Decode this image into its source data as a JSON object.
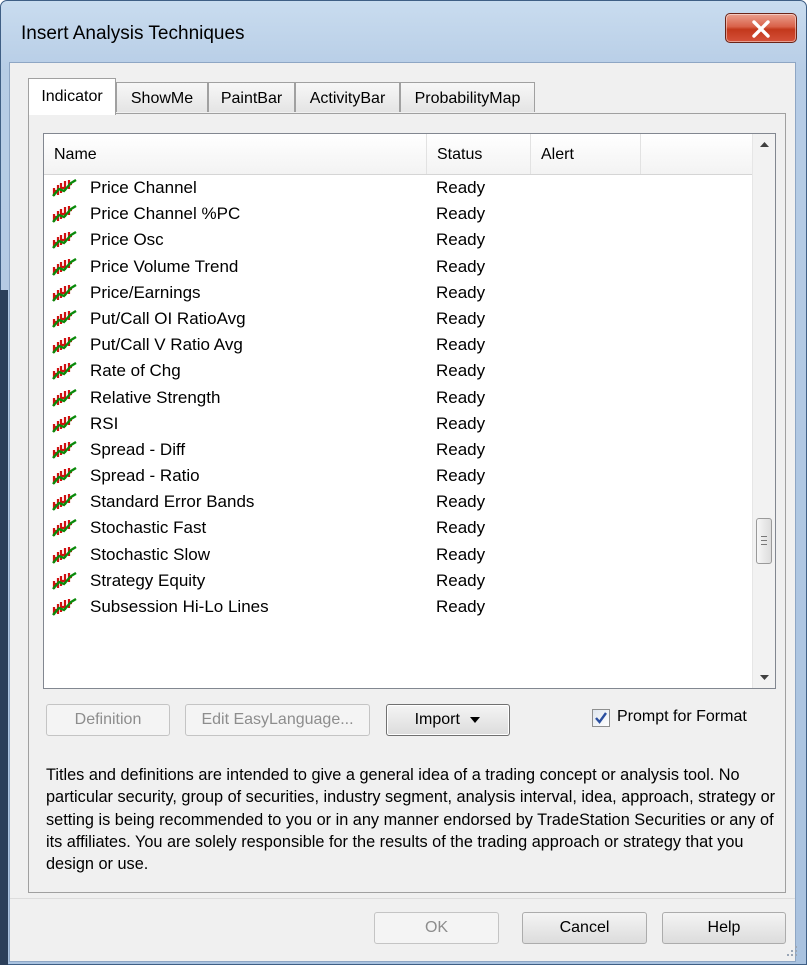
{
  "window": {
    "title": "Insert Analysis Techniques",
    "close_icon": "close-icon"
  },
  "tabs": [
    {
      "label": "Indicator",
      "active": true
    },
    {
      "label": "ShowMe",
      "active": false
    },
    {
      "label": "PaintBar",
      "active": false
    },
    {
      "label": "ActivityBar",
      "active": false
    },
    {
      "label": "ProbabilityMap",
      "active": false
    }
  ],
  "list": {
    "columns": [
      "Name",
      "Status",
      "Alert"
    ],
    "row_icon": "indicator-chart-icon",
    "rows": [
      {
        "name": "Price Channel",
        "status": "Ready"
      },
      {
        "name": "Price Channel %PC",
        "status": "Ready"
      },
      {
        "name": "Price Osc",
        "status": "Ready"
      },
      {
        "name": "Price Volume Trend",
        "status": "Ready"
      },
      {
        "name": "Price/Earnings",
        "status": "Ready"
      },
      {
        "name": "Put/Call OI RatioAvg",
        "status": "Ready"
      },
      {
        "name": "Put/Call V Ratio Avg",
        "status": "Ready"
      },
      {
        "name": "Rate of Chg",
        "status": "Ready"
      },
      {
        "name": "Relative Strength",
        "status": "Ready"
      },
      {
        "name": "RSI",
        "status": "Ready"
      },
      {
        "name": "Spread - Diff",
        "status": "Ready"
      },
      {
        "name": "Spread - Ratio",
        "status": "Ready"
      },
      {
        "name": "Standard Error Bands",
        "status": "Ready"
      },
      {
        "name": "Stochastic Fast",
        "status": "Ready"
      },
      {
        "name": "Stochastic Slow",
        "status": "Ready"
      },
      {
        "name": "Strategy Equity",
        "status": "Ready"
      },
      {
        "name": "Subsession Hi-Lo Lines",
        "status": "Ready"
      }
    ]
  },
  "actions": {
    "definition": "Definition",
    "edit_easylanguage": "Edit EasyLanguage...",
    "import": "Import",
    "prompt_for_format": "Prompt for Format",
    "prompt_for_format_checked": true
  },
  "disclaimer": "Titles and definitions are intended to give a general idea of a trading concept or analysis tool. No particular security, group of securities, industry segment, analysis interval, idea, approach, strategy or setting is being recommended to you or in any manner endorsed by TradeStation Securities or any of its affiliates. You are solely responsible for the results of the trading approach or strategy that you design or use.",
  "footer": {
    "ok": "OK",
    "cancel": "Cancel",
    "help": "Help"
  },
  "colors": {
    "icon_red": "#d01010",
    "icon_green": "#0a8a0a",
    "close_red": "#c3381c",
    "check_blue": "#2a4fa0"
  }
}
